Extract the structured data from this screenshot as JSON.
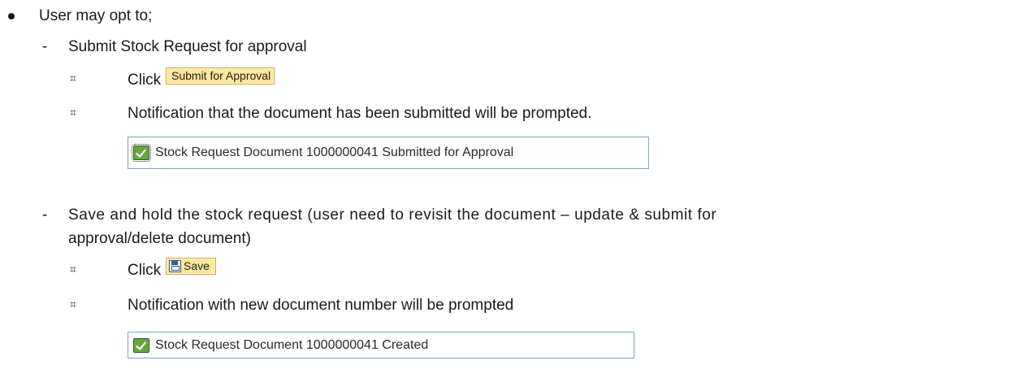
{
  "intro": "User may opt to;",
  "option1": {
    "heading": "Submit Stock Request for approval",
    "click_label": "Click",
    "button_label": "Submit for Approval",
    "notification_text": "Notification that the document has been submitted will be prompted.",
    "message": "Stock Request Document 1000000041 Submitted for Approval"
  },
  "option2": {
    "heading_line1": "Save and hold the stock request (user need to revisit the document – update & submit for",
    "heading_line2": "approval/delete document)",
    "click_label": "Click",
    "button_label": "Save",
    "button_icon": "save-disk-icon",
    "notification_text": "Notification with new document number will be prompted",
    "message": "Stock Request Document 1000000041 Created"
  },
  "sub_bullet_glyph": "⌗",
  "colors": {
    "button_bg": "#fde79a",
    "button_border": "#c8a64a",
    "message_border": "#7ea2c9",
    "check_green": "#66a83b"
  }
}
